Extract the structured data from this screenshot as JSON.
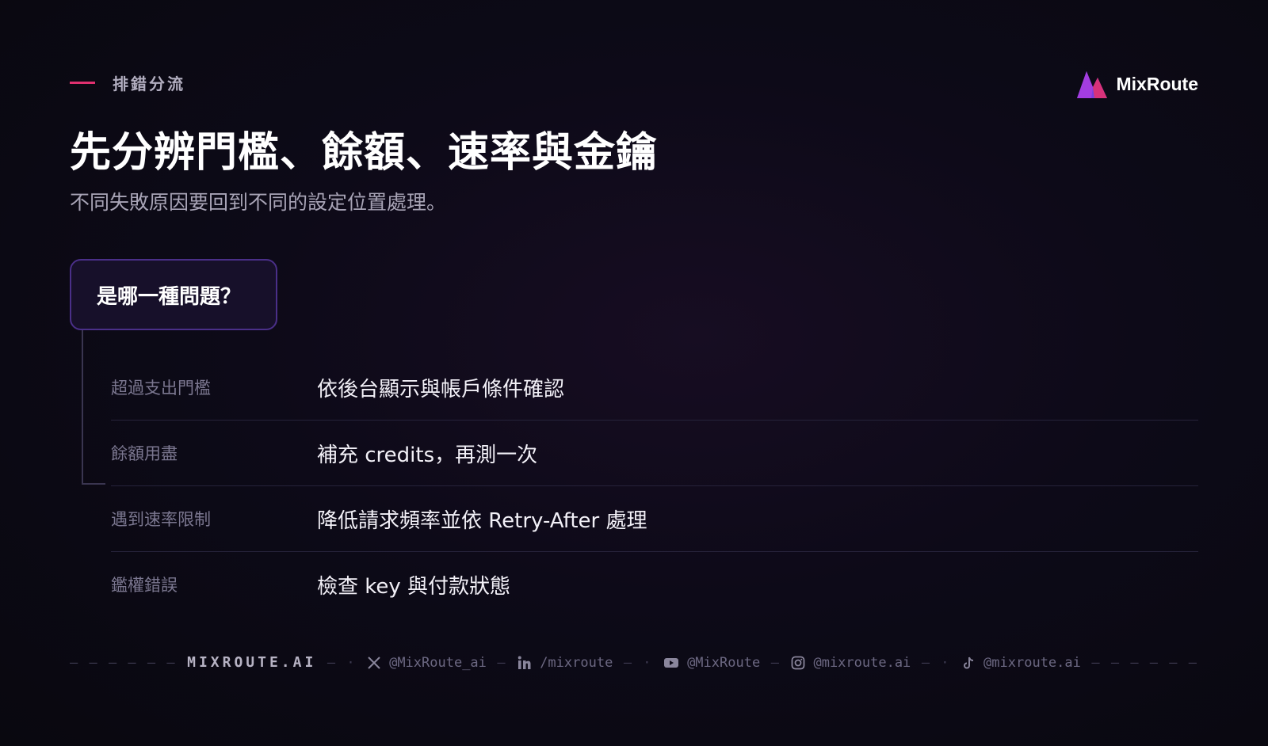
{
  "eyebrow": "排錯分流",
  "brand": {
    "name": "MixRoute"
  },
  "title": "先分辨門檻、餘額、速率與金鑰",
  "subtitle": "不同失敗原因要回到不同的設定位置處理。",
  "question": "是哪一種問題？",
  "rows": [
    {
      "label": "超過支出門檻",
      "action": "依後台顯示與帳戶條件確認"
    },
    {
      "label": "餘額用盡",
      "action": "補充 credits，再測一次"
    },
    {
      "label": "遇到速率限制",
      "action": "降低請求頻率並依 Retry-After 處理"
    },
    {
      "label": "鑑權錯誤",
      "action": "檢查 key 與付款狀態"
    }
  ],
  "footer": {
    "site": "MIXROUTE.AI",
    "socials": [
      {
        "icon": "x-icon",
        "handle": "@MixRoute_ai"
      },
      {
        "icon": "linkedin-icon",
        "handle": "/mixroute"
      },
      {
        "icon": "youtube-icon",
        "handle": "@MixRoute"
      },
      {
        "icon": "instagram-icon",
        "handle": "@mixroute.ai"
      },
      {
        "icon": "tiktok-icon",
        "handle": "@mixroute.ai"
      }
    ]
  },
  "colors": {
    "accent": "#e0306f",
    "question_border": "#4a2f88",
    "background": "#0d0a18"
  }
}
